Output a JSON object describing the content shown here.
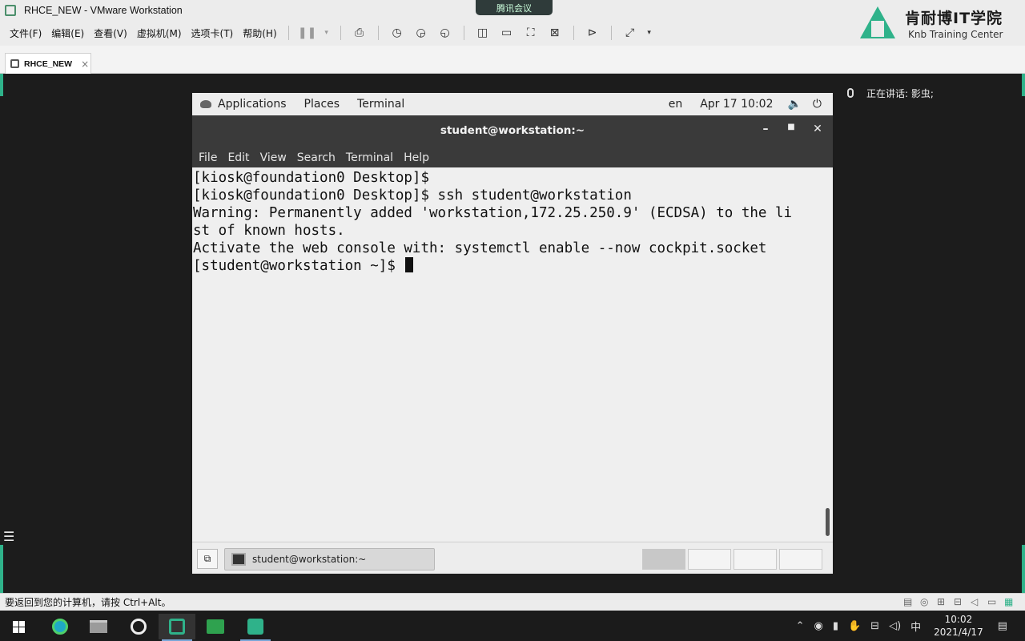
{
  "window": {
    "title": "RHCE_NEW - VMware Workstation",
    "meeting_pill": "腾讯会议"
  },
  "vmware_menu": [
    "文件(F)",
    "编辑(E)",
    "查看(V)",
    "虚拟机(M)",
    "选项卡(T)",
    "帮助(H)"
  ],
  "logo": {
    "cn": "肯耐博IT学院",
    "en": "Knb Training Center"
  },
  "tab": {
    "label": "RHCE_NEW",
    "close": "×"
  },
  "gnome_topbar": {
    "applications": "Applications",
    "places": "Places",
    "terminal": "Terminal",
    "lang": "en",
    "datetime": "Apr 17  10:02"
  },
  "terminal": {
    "title": "student@workstation:~",
    "menu": [
      "File",
      "Edit",
      "View",
      "Search",
      "Terminal",
      "Help"
    ],
    "lines": [
      "[kiosk@foundation0 Desktop]$",
      "[kiosk@foundation0 Desktop]$ ssh student@workstation",
      "Warning: Permanently added 'workstation,172.25.250.9' (ECDSA) to the li",
      "st of known hosts.",
      "Activate the web console with: systemctl enable --now cockpit.socket",
      "",
      "[student@workstation ~]$ "
    ]
  },
  "gnome_taskbar": {
    "task_label": "student@workstation:~"
  },
  "meeting": {
    "speaking": "正在讲话: 影虫;"
  },
  "status": {
    "message": "要返回到您的计算机，请按 Ctrl+Alt。"
  },
  "clock": {
    "time": "10:02",
    "date": "2021/4/17"
  },
  "tray": {
    "ime": "中"
  }
}
